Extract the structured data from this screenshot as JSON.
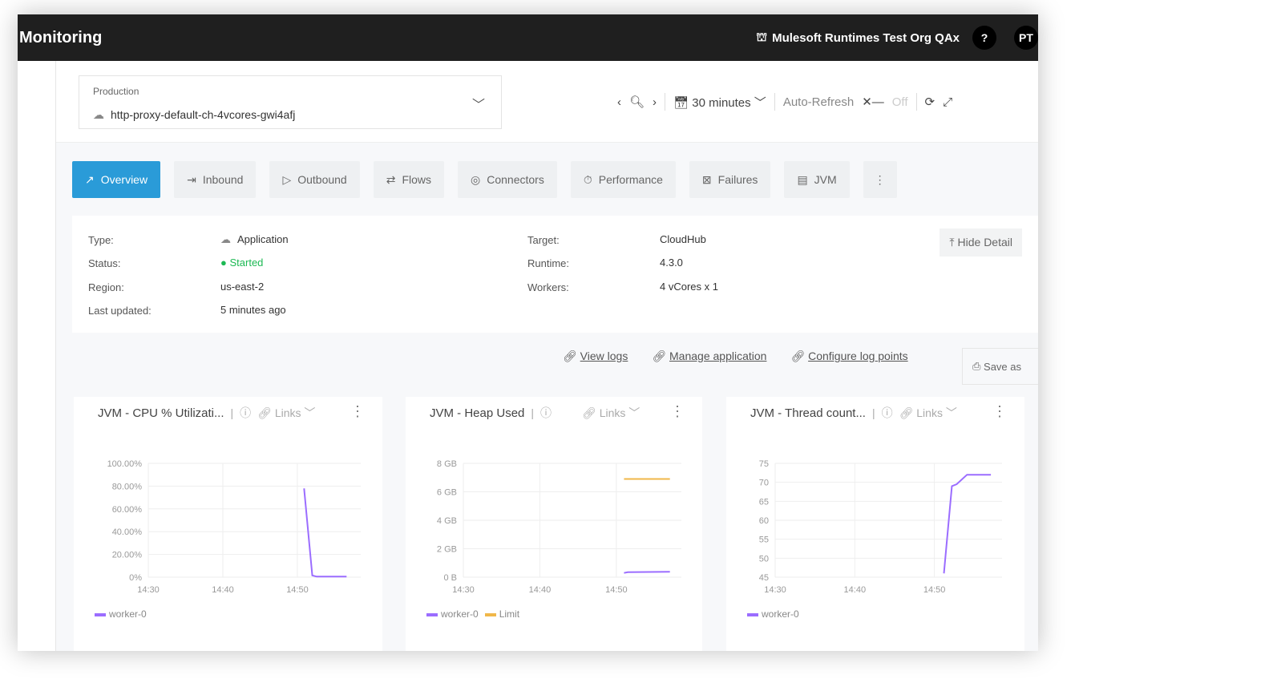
{
  "header": {
    "title": "Monitoring",
    "org": "Mulesoft Runtimes Test Org QAx",
    "help": "?",
    "avatar": "PT"
  },
  "selector": {
    "environment": "Production",
    "application": "http-proxy-default-ch-4vcores-gwi4afj"
  },
  "time": {
    "range": "30 minutes",
    "auto_refresh_label": "Auto-Refresh",
    "auto_refresh_state": "Off"
  },
  "tabs": [
    {
      "label": "Overview",
      "icon": "chart-icon"
    },
    {
      "label": "Inbound",
      "icon": "inbound-icon"
    },
    {
      "label": "Outbound",
      "icon": "outbound-icon"
    },
    {
      "label": "Flows",
      "icon": "flows-icon"
    },
    {
      "label": "Connectors",
      "icon": "connector-icon"
    },
    {
      "label": "Performance",
      "icon": "stopwatch-icon"
    },
    {
      "label": "Failures",
      "icon": "failure-icon"
    },
    {
      "label": "JVM",
      "icon": "server-icon"
    }
  ],
  "details": {
    "type_label": "Type:",
    "type": "Application",
    "status_label": "Status:",
    "status": "Started",
    "region_label": "Region:",
    "region": "us-east-2",
    "updated_label": "Last updated:",
    "updated": "5 minutes ago",
    "target_label": "Target:",
    "target": "CloudHub",
    "runtime_label": "Runtime:",
    "runtime": "4.3.0",
    "workers_label": "Workers:",
    "workers": "4 vCores x 1",
    "hide": "Hide Detail",
    "status_color": "#1db954"
  },
  "links": {
    "view_logs": "View logs",
    "manage": "Manage application",
    "configure": "Configure log points",
    "save_as": "Save as"
  },
  "cards": {
    "links_label": "Links"
  },
  "chart_data": [
    {
      "type": "line",
      "title": "JVM - CPU % Utilizati...",
      "x_unit": "minutes after 14:30",
      "xlim": [
        0,
        28.5
      ],
      "xticks": [
        "14:30",
        "14:40",
        "14:50"
      ],
      "ylim": [
        0,
        100
      ],
      "yticks": [
        "0%",
        "20.00%",
        "40.00%",
        "60.00%",
        "80.00%",
        "100.00%"
      ],
      "series": [
        {
          "name": "worker-0",
          "color": "#9b6dff",
          "points": [
            [
              20.9,
              78
            ],
            [
              22,
              1.5
            ],
            [
              22.6,
              0.5
            ],
            [
              26.6,
              0.5
            ]
          ]
        }
      ]
    },
    {
      "type": "line",
      "title": "JVM - Heap Used",
      "x_unit": "minutes after 14:30",
      "xlim": [
        0,
        28.5
      ],
      "xticks": [
        "14:30",
        "14:40",
        "14:50"
      ],
      "ylim": [
        0,
        8
      ],
      "yticks": [
        "0 B",
        "2 GB",
        "4 GB",
        "6 GB",
        "8 GB"
      ],
      "series": [
        {
          "name": "worker-0",
          "color": "#9b6dff",
          "points": [
            [
              21,
              0.3
            ],
            [
              21.5,
              0.35
            ],
            [
              27,
              0.38
            ]
          ]
        },
        {
          "name": "Limit",
          "color": "#f0b74a",
          "points": [
            [
              21,
              6.9
            ],
            [
              27,
              6.9
            ]
          ]
        }
      ]
    },
    {
      "type": "line",
      "title": "JVM - Thread count...",
      "x_unit": "minutes after 14:30",
      "xlim": [
        0,
        28.5
      ],
      "xticks": [
        "14:30",
        "14:40",
        "14:50"
      ],
      "ylim": [
        45,
        75
      ],
      "yticks": [
        "45",
        "50",
        "55",
        "60",
        "65",
        "70",
        "75"
      ],
      "series": [
        {
          "name": "worker-0",
          "color": "#9b6dff",
          "points": [
            [
              21.2,
              46
            ],
            [
              22.2,
              69
            ],
            [
              22.8,
              69.5
            ],
            [
              24.1,
              72
            ],
            [
              27.1,
              72
            ]
          ]
        }
      ]
    }
  ]
}
